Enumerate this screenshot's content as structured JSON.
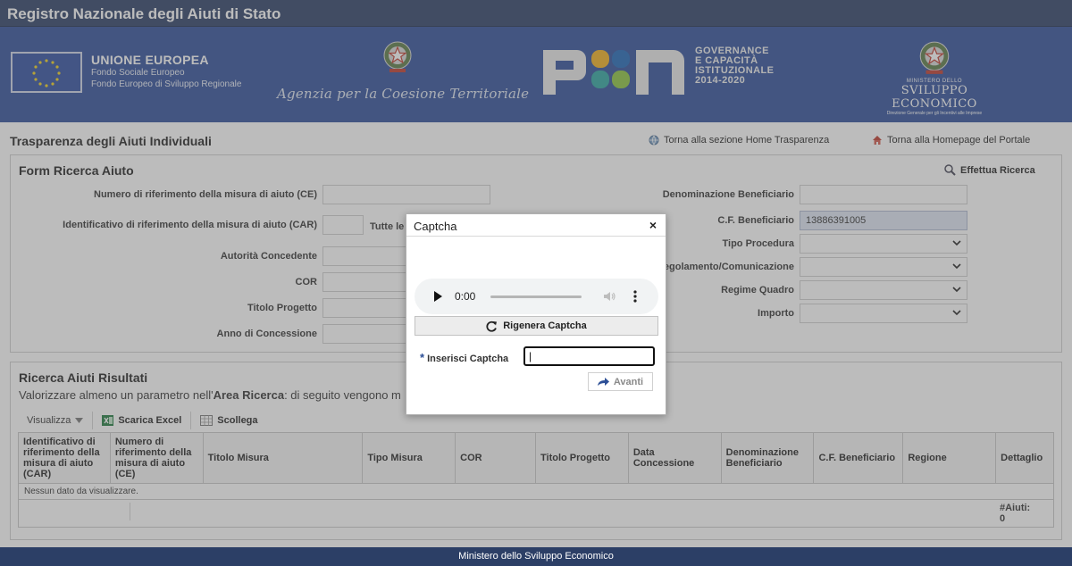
{
  "header": {
    "title": "Registro Nazionale degli Aiuti di Stato"
  },
  "banner": {
    "eu_title": "UNIONE EUROPEA",
    "eu_line1": "Fondo Sociale Europeo",
    "eu_line2": "Fondo Europeo di Sviluppo Regionale",
    "agency": "Agenzia per la Coesione Territoriale",
    "pon_line1": "GOVERNANCE",
    "pon_line2": "E CAPACITÀ",
    "pon_line3": "ISTITUZIONALE",
    "pon_line4": "2014-2020",
    "mise_line1": "MINISTERO DELLO",
    "mise_line2": "SVILUPPO ECONOMICO",
    "mise_line3": "Direzione Generale per gli Incentivi alle Imprese"
  },
  "page": {
    "title": "Trasparenza degli Aiuti Individuali",
    "link_home_trasparenza": "Torna alla sezione Home Trasparenza",
    "link_home_portale": "Torna alla Homepage del Portale"
  },
  "form": {
    "title": "Form Ricerca Aiuto",
    "search_label": "Effettua Ricerca",
    "labels": {
      "ce": "Numero di riferimento della misura di aiuto (CE)",
      "car": "Identificativo di riferimento della misura di aiuto (CAR)",
      "tutte": "Tutte le",
      "autorita": "Autorità Concedente",
      "cor": "COR",
      "titolo_progetto": "Titolo Progetto",
      "anno": "Anno di Concessione",
      "denominazione": "Denominazione Beneficiario",
      "cf": "C.F. Beneficiario",
      "tipo_procedura": "Tipo Procedura",
      "regolamento": "Regolamento/Comunicazione",
      "regime": "Regime Quadro",
      "importo": "Importo"
    },
    "values": {
      "cf": "13886391005"
    }
  },
  "results": {
    "title": "Ricerca Aiuti Risultati",
    "subtitle_pre": "Valorizzare almeno un parametro nell'",
    "subtitle_bold": "Area Ricerca",
    "subtitle_post": ": di seguito vengono m",
    "toolbar": {
      "visualizza": "Visualizza",
      "scarica": "Scarica Excel",
      "scollega": "Scollega"
    },
    "columns": [
      "Identificativo di riferimento della misura di aiuto (CAR)",
      "Numero di riferimento della misura di aiuto (CE)",
      "Titolo Misura",
      "Tipo Misura",
      "COR",
      "Titolo Progetto",
      "Data Concessione",
      "Denominazione Beneficiario",
      "C.F. Beneficiario",
      "Regione",
      "Dettaglio"
    ],
    "empty_message": "Nessun dato da visualizzare.",
    "count_label": "#Aiuti:",
    "count_value": "0"
  },
  "dialog": {
    "title": "Captcha",
    "close": "×",
    "audio_time": "0:00",
    "regen_label": "Rigenera Captcha",
    "input_label": "Inserisci Captcha",
    "required_mark": "*",
    "input_value": "|",
    "next_label": "Avanti"
  },
  "footer": {
    "text": "Ministero dello Sviluppo Economico"
  },
  "colors": {
    "header_bg": "#2c3f66",
    "banner_bg": "#2f4f99",
    "accent": "#2c4f96"
  }
}
